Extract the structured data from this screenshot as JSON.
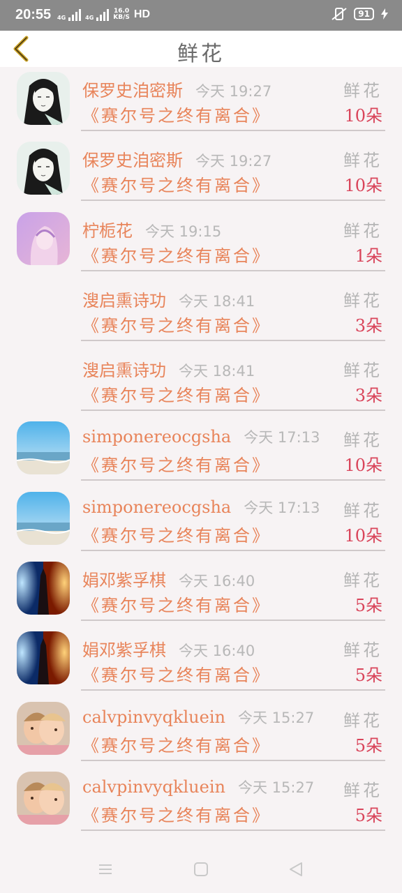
{
  "status": {
    "time": "20:55",
    "net1": "4G",
    "net2": "4G",
    "speed": "16.0",
    "speed_unit": "KB/S",
    "hd": "HD",
    "battery": "91"
  },
  "header": {
    "title": "鲜花",
    "back_icon": "chevron-left-icon"
  },
  "colors": {
    "name": "#e8845a",
    "amount": "#d9445a",
    "muted": "#b5b5b5"
  },
  "list": [
    {
      "avatar": "anime-avatar",
      "name": "保罗史洎密斯",
      "time": "今天 19:27",
      "type": "鲜花",
      "book": "《赛尔号之终有离合》",
      "amount": "10朵"
    },
    {
      "avatar": "anime-avatar",
      "name": "保罗史洎密斯",
      "time": "今天 19:27",
      "type": "鲜花",
      "book": "《赛尔号之终有离合》",
      "amount": "10朵"
    },
    {
      "avatar": "purple-girl-avatar",
      "name": "柠栀花",
      "time": "今天 19:15",
      "type": "鲜花",
      "book": "《赛尔号之终有离合》",
      "amount": "1朵"
    },
    {
      "avatar": "none",
      "name": "溲启熏诗功",
      "time": "今天 18:41",
      "type": "鲜花",
      "book": "《赛尔号之终有离合》",
      "amount": "3朵"
    },
    {
      "avatar": "none",
      "name": "溲启熏诗功",
      "time": "今天 18:41",
      "type": "鲜花",
      "book": "《赛尔号之终有离合》",
      "amount": "3朵"
    },
    {
      "avatar": "beach-avatar",
      "name": "simponereocgsha",
      "time": "今天 17:13",
      "type": "鲜花",
      "book": "《赛尔号之终有离合》",
      "amount": "10朵"
    },
    {
      "avatar": "beach-avatar",
      "name": "simponereocgsha",
      "time": "今天 17:13",
      "type": "鲜花",
      "book": "《赛尔号之终有离合》",
      "amount": "10朵"
    },
    {
      "avatar": "fire-ice-avatar",
      "name": "娟邓紫孚棋",
      "time": "今天 16:40",
      "type": "鲜花",
      "book": "《赛尔号之终有离合》",
      "amount": "5朵"
    },
    {
      "avatar": "fire-ice-avatar",
      "name": "娟邓紫孚棋",
      "time": "今天 16:40",
      "type": "鲜花",
      "book": "《赛尔号之终有离合》",
      "amount": "5朵"
    },
    {
      "avatar": "kids-avatar",
      "name": "calvpinvyqkluein",
      "time": "今天 15:27",
      "type": "鲜花",
      "book": "《赛尔号之终有离合》",
      "amount": "5朵"
    },
    {
      "avatar": "kids-avatar",
      "name": "calvpinvyqkluein",
      "time": "今天 15:27",
      "type": "鲜花",
      "book": "《赛尔号之终有离合》",
      "amount": "5朵"
    }
  ],
  "navbar": {
    "icons": [
      "menu-icon",
      "home-icon",
      "back-triangle-icon"
    ]
  }
}
